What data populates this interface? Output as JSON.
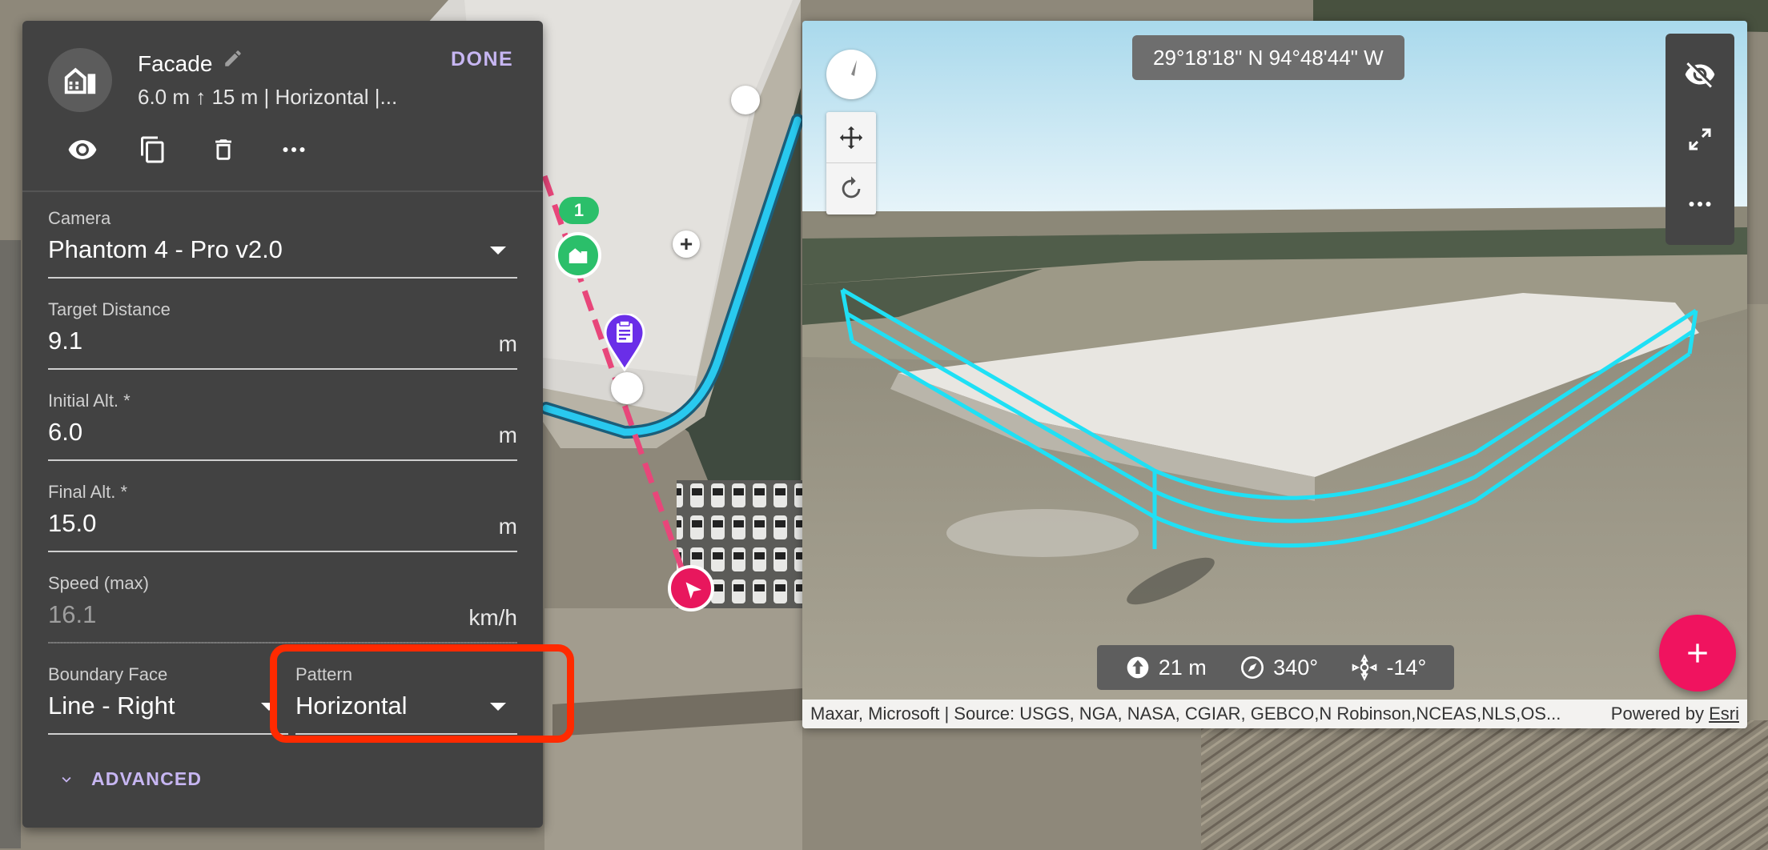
{
  "panel": {
    "title": "Facade",
    "subtitle": "6.0 m ↑ 15 m | Horizontal |...",
    "done_label": "DONE",
    "icons": [
      "facade-icon",
      "edit-icon",
      "visibility-icon",
      "copy-icon",
      "delete-icon",
      "more-icon"
    ],
    "fields": {
      "camera": {
        "label": "Camera",
        "value": "Phantom 4 - Pro v2.0"
      },
      "target_distance": {
        "label": "Target Distance",
        "value": "9.1",
        "unit": "m"
      },
      "initial_alt": {
        "label": "Initial Alt. *",
        "value": "6.0",
        "unit": "m"
      },
      "final_alt": {
        "label": "Final Alt. *",
        "value": "15.0",
        "unit": "m"
      },
      "speed": {
        "label": "Speed (max)",
        "value": "16.1",
        "unit": "km/h"
      },
      "boundary_face": {
        "label": "Boundary Face",
        "value": "Line - Right"
      },
      "pattern": {
        "label": "Pattern",
        "value": "Horizontal"
      }
    },
    "advanced_label": "ADVANCED"
  },
  "map": {
    "marker_badge": "1",
    "colors": {
      "flight_path": "#29c9ef",
      "route": "#e8467a",
      "facade_marker": "#2bbf6a",
      "note_marker": "#6a2ee8",
      "start_marker": "#e8175d"
    }
  },
  "view3d": {
    "coordinates": "29°18'18\" N 94°48'44\" W",
    "stats": {
      "altitude": "21 m",
      "heading": "340°",
      "gimbal": "-14°"
    },
    "attribution": "Maxar, Microsoft | Source: USGS, NGA, NASA, CGIAR, GEBCO,N Robinson,NCEAS,NLS,OS...",
    "powered_by": "Powered by",
    "powered_by_link": "Esri",
    "colors": {
      "path": "#1fe0f5",
      "fab": "#f0135f"
    }
  }
}
